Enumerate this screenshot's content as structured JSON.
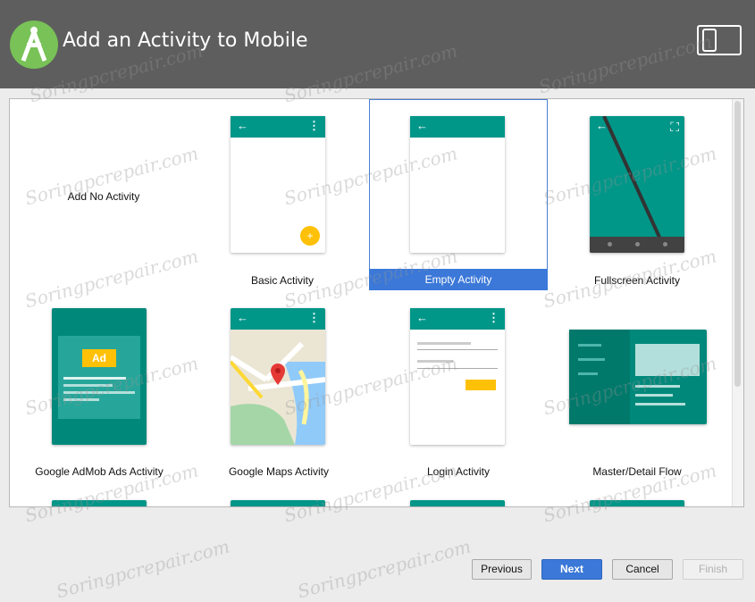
{
  "header": {
    "title": "Add an Activity to Mobile"
  },
  "tiles": [
    {
      "label": "Add No Activity"
    },
    {
      "label": "Basic Activity"
    },
    {
      "label": "Empty Activity"
    },
    {
      "label": "Fullscreen Activity"
    },
    {
      "label": "Google AdMob Ads Activity"
    },
    {
      "label": "Google Maps Activity"
    },
    {
      "label": "Login Activity"
    },
    {
      "label": "Master/Detail Flow"
    }
  ],
  "admob": {
    "ad_label": "Ad"
  },
  "buttons": {
    "previous": "Previous",
    "next": "Next",
    "cancel": "Cancel",
    "finish": "Finish"
  },
  "watermark": "Soringpcrepair.com",
  "colors": {
    "teal": "#009688",
    "selection": "#3b78d8",
    "fab": "#ffc107",
    "header": "#5e5e5e"
  }
}
